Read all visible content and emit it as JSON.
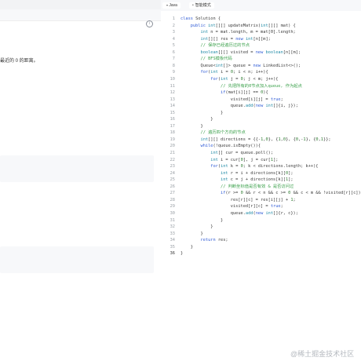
{
  "toolbar": {
    "language_label": "Java",
    "mode_label": "智能模式"
  },
  "problem": {
    "description_fragment": "最近的 0 的距离。"
  },
  "editor": {
    "lines": [
      [
        [
          "kw",
          "class "
        ],
        [
          "",
          "Solution {"
        ]
      ],
      [
        [
          "",
          "    "
        ],
        [
          "kw",
          "public "
        ],
        [
          "ty",
          "int"
        ],
        [
          "",
          "[][] updateMatrix("
        ],
        [
          "ty",
          "int"
        ],
        [
          "",
          "[][] mat) {"
        ]
      ],
      [
        [
          "",
          "        "
        ],
        [
          "ty",
          "int "
        ],
        [
          "",
          "n = mat.length, m = mat[0].length;"
        ]
      ],
      [
        [
          "",
          "        "
        ],
        [
          "ty",
          "int"
        ],
        [
          "",
          "[][] res = "
        ],
        [
          "kw",
          "new "
        ],
        [
          "ty",
          "int"
        ],
        [
          "",
          "[n][m];"
        ]
      ],
      [
        [
          "cm",
          "        // 保存已经遍历过的节点"
        ]
      ],
      [
        [
          "",
          "        "
        ],
        [
          "ty",
          "boolean"
        ],
        [
          "",
          "[][] visited = "
        ],
        [
          "kw",
          "new "
        ],
        [
          "ty",
          "boolean"
        ],
        [
          "",
          "[n][m];"
        ]
      ],
      [
        [
          "cm",
          "        // BFS模板代码"
        ]
      ],
      [
        [
          "",
          "        Queue<"
        ],
        [
          "ty",
          "int"
        ],
        [
          "",
          "[]> queue = "
        ],
        [
          "kw",
          "new "
        ],
        [
          "",
          "LinkedList<>();"
        ]
      ],
      [
        [
          "",
          "        "
        ],
        [
          "kw",
          "for"
        ],
        [
          "",
          "("
        ],
        [
          "ty",
          "int "
        ],
        [
          "",
          "i = "
        ],
        [
          "num",
          "0"
        ],
        [
          "",
          "; i < n; i++){"
        ]
      ],
      [
        [
          "",
          "            "
        ],
        [
          "kw",
          "for"
        ],
        [
          "",
          "("
        ],
        [
          "ty",
          "int "
        ],
        [
          "",
          "j = "
        ],
        [
          "num",
          "0"
        ],
        [
          "",
          "; j < m; j++){"
        ]
      ],
      [
        [
          "cm",
          "                // 先把所有的0节点加入queue, 作为起点"
        ]
      ],
      [
        [
          "",
          "                "
        ],
        [
          "kw",
          "if"
        ],
        [
          "",
          "(mat[i][j] == "
        ],
        [
          "num",
          "0"
        ],
        [
          "",
          "){"
        ]
      ],
      [
        [
          "",
          "                    visited[i][j] = "
        ],
        [
          "kw",
          "true"
        ],
        [
          "",
          ";"
        ]
      ],
      [
        [
          "",
          "                    queue."
        ],
        [
          "ty",
          "add"
        ],
        [
          "",
          "("
        ],
        [
          "kw",
          "new "
        ],
        [
          "ty",
          "int"
        ],
        [
          "",
          "[]{i, j});"
        ]
      ],
      [
        [
          "",
          "                }"
        ]
      ],
      [
        [
          "",
          "            }"
        ]
      ],
      [
        [
          "",
          "        }"
        ]
      ],
      [
        [
          "cm",
          "        // 遍历四个方向的节点"
        ]
      ],
      [
        [
          "",
          "        "
        ],
        [
          "ty",
          "int"
        ],
        [
          "",
          "[][] directions = {{-"
        ],
        [
          "num",
          "1"
        ],
        [
          "",
          ","
        ],
        [
          "num",
          "0"
        ],
        [
          "",
          "}, {"
        ],
        [
          "num",
          "1"
        ],
        [
          "",
          ","
        ],
        [
          "num",
          "0"
        ],
        [
          "",
          "}, {"
        ],
        [
          "num",
          "0"
        ],
        [
          "",
          ",-"
        ],
        [
          "num",
          "1"
        ],
        [
          "",
          "}, {"
        ],
        [
          "num",
          "0"
        ],
        [
          "",
          ","
        ],
        [
          "num",
          "1"
        ],
        [
          "",
          "}};"
        ]
      ],
      [
        [
          "",
          "        "
        ],
        [
          "kw",
          "while"
        ],
        [
          "",
          "(!queue.isEmpty()){"
        ]
      ],
      [
        [
          "",
          "            "
        ],
        [
          "ty",
          "int"
        ],
        [
          "",
          "[] cur = queue.poll();"
        ]
      ],
      [
        [
          "",
          "            "
        ],
        [
          "ty",
          "int "
        ],
        [
          "",
          "i = cur["
        ],
        [
          "num",
          "0"
        ],
        [
          "",
          "], j = cur["
        ],
        [
          "num",
          "1"
        ],
        [
          "",
          "];"
        ]
      ],
      [
        [
          "",
          "            "
        ],
        [
          "kw",
          "for"
        ],
        [
          "",
          "("
        ],
        [
          "ty",
          "int "
        ],
        [
          "",
          "k = "
        ],
        [
          "num",
          "0"
        ],
        [
          "",
          "; k < directions.length; k++){"
        ]
      ],
      [
        [
          "",
          "                "
        ],
        [
          "ty",
          "int "
        ],
        [
          "",
          "r = i + directions[k]["
        ],
        [
          "num",
          "0"
        ],
        [
          "",
          "];"
        ]
      ],
      [
        [
          "",
          "                "
        ],
        [
          "ty",
          "int "
        ],
        [
          "",
          "c = j + directions[k]["
        ],
        [
          "num",
          "1"
        ],
        [
          "",
          "];"
        ]
      ],
      [
        [
          "cm",
          "                // 判断坐标值是否有效 & 是否访问过"
        ]
      ],
      [
        [
          "",
          "                "
        ],
        [
          "kw",
          "if"
        ],
        [
          "",
          "(r >= "
        ],
        [
          "num",
          "0"
        ],
        [
          "",
          " && r < n && c >= "
        ],
        [
          "num",
          "0"
        ],
        [
          "",
          " && c < m && !visited[r][c]){"
        ]
      ],
      [
        [
          "",
          "                    res[r][c] = res[i][j] + "
        ],
        [
          "num",
          "1"
        ],
        [
          "",
          ";"
        ]
      ],
      [
        [
          "",
          "                    visited[r][c] = "
        ],
        [
          "kw",
          "true"
        ],
        [
          "",
          ";"
        ]
      ],
      [
        [
          "",
          "                    queue."
        ],
        [
          "ty",
          "add"
        ],
        [
          "",
          "("
        ],
        [
          "kw",
          "new "
        ],
        [
          "ty",
          "int"
        ],
        [
          "",
          "[]{r, c});"
        ]
      ],
      [
        [
          "",
          "                }"
        ]
      ],
      [
        [
          "",
          "            }"
        ]
      ],
      [
        [
          "",
          "        }"
        ]
      ],
      [
        [
          "",
          "        "
        ],
        [
          "kw",
          "return "
        ],
        [
          "",
          "res;"
        ]
      ],
      [
        [
          "",
          "    }"
        ]
      ],
      [
        [
          "",
          "}"
        ]
      ]
    ]
  },
  "watermark": "@稀土掘金技术社区"
}
